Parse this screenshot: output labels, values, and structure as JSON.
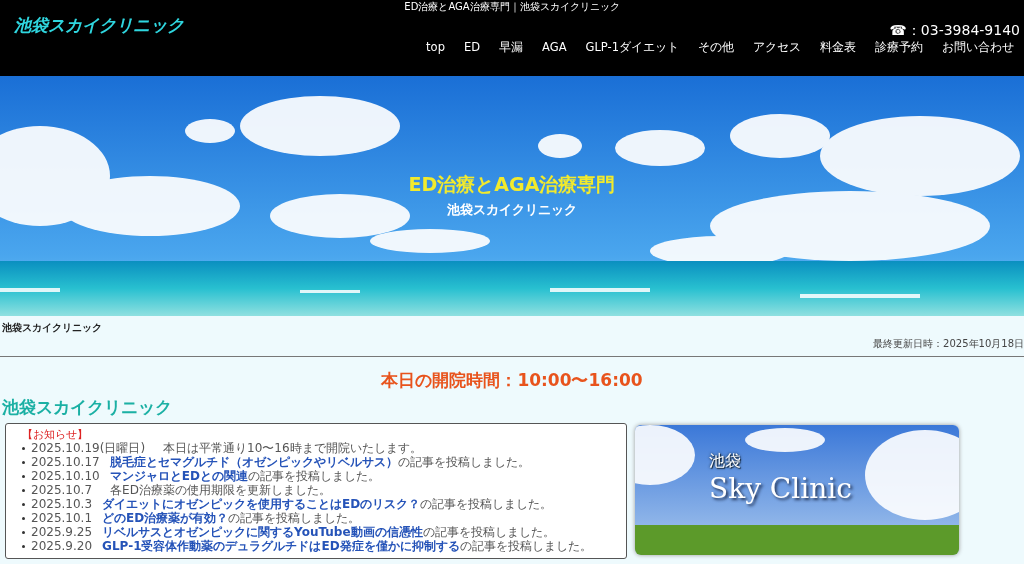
{
  "page_title": "ED治療とAGA治療専門｜池袋スカイクリニック",
  "header": {
    "logo": "池袋スカイクリニック",
    "phone": "☎：03-3984-9140"
  },
  "nav": [
    "top",
    "ED",
    "早漏",
    "AGA",
    "GLP-1ダイエット",
    "その他",
    "アクセス",
    "料金表",
    "診療予約",
    "お問い合わせ"
  ],
  "hero": {
    "headline": "ED治療とAGA治療専門",
    "subtitle": "池袋スカイクリニック"
  },
  "breadcrumb": "池袋スカイクリニック",
  "last_updated": "最終更新日時：2025年10月18日",
  "hours": "本日の開院時間：10:00〜16:00",
  "clinic_heading": "池袋スカイクリニック",
  "news": {
    "title": "【お知らせ】",
    "items": [
      {
        "date": "2025.10.19(日曜日)",
        "text": "本日は平常通り10〜16時まで開院いたします。"
      },
      {
        "date": "2025.10.17",
        "link": "脱毛症とセマグルチド（オゼンピックやリベルサス）",
        "text": "の記事を投稿しました。"
      },
      {
        "date": "2025.10.10",
        "link": "マンジャロとEDとの関連",
        "text": "の記事を投稿しました。"
      },
      {
        "date": "2025.10.7",
        "text": "各ED治療薬の使用期限を更新しました。"
      },
      {
        "date": "2025.10.3",
        "link": "ダイエットにオゼンピックを使用することはEDのリスク？",
        "text": "の記事を投稿しました。"
      },
      {
        "date": "2025.10.1",
        "link": "どのED治療薬が有効？",
        "text": "の記事を投稿しました。"
      },
      {
        "date": "2025.9.25",
        "link": "リベルサスとオゼンピックに関するYouTube動画の信憑性",
        "text": "の記事を投稿しました。"
      },
      {
        "date": "2025.9.20",
        "link": "GLP-1受容体作動薬のデュラグルチドはED発症を僅かに抑制する",
        "text": "の記事を投稿しました。"
      }
    ]
  },
  "banner": {
    "kanji": "池袋",
    "name": "Sky Clinic"
  }
}
